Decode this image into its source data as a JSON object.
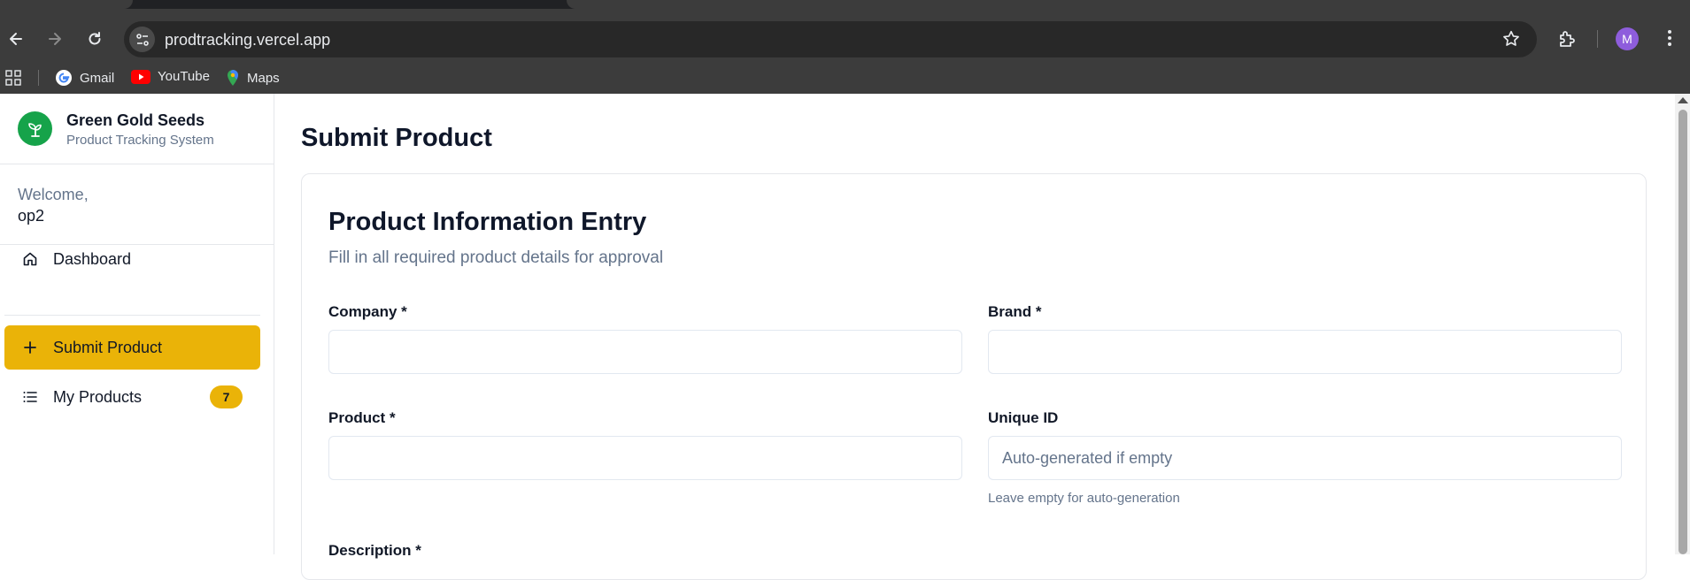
{
  "browser": {
    "url": "prodtracking.vercel.app",
    "profile_initial": "M",
    "bookmarks": [
      {
        "label": "Gmail",
        "icon": "google-g-icon"
      },
      {
        "label": "YouTube",
        "icon": "youtube-icon"
      },
      {
        "label": "Maps",
        "icon": "maps-pin-icon"
      }
    ]
  },
  "sidebar": {
    "brand_name": "Green Gold Seeds",
    "brand_subtitle": "Product Tracking System",
    "welcome_label": "Welcome,",
    "username": "op2",
    "items": [
      {
        "label": "Dashboard",
        "icon": "home-icon",
        "active": false
      },
      {
        "label": "Submit Product",
        "icon": "plus-icon",
        "active": true
      },
      {
        "label": "My Products",
        "icon": "list-icon",
        "active": false,
        "badge": "7"
      }
    ]
  },
  "main": {
    "title": "Submit Product",
    "card": {
      "title": "Product Information Entry",
      "subtitle": "Fill in all required product details for approval",
      "fields": {
        "company": {
          "label": "Company *",
          "value": "",
          "placeholder": ""
        },
        "brand": {
          "label": "Brand *",
          "value": "",
          "placeholder": ""
        },
        "product": {
          "label": "Product *",
          "value": "",
          "placeholder": ""
        },
        "unique_id": {
          "label": "Unique ID",
          "value": "",
          "placeholder": "Auto-generated if empty",
          "help": "Leave empty for auto-generation"
        },
        "description": {
          "label": "Description *"
        }
      }
    }
  },
  "colors": {
    "accent": "#eab308",
    "brand_green": "#16a34a",
    "chrome_bg": "#3c3c3c",
    "muted_text": "#64748b"
  }
}
